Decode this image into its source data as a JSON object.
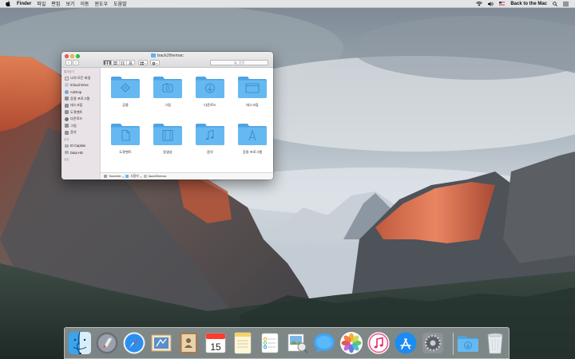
{
  "menubar": {
    "app_name": "Finder",
    "menus": [
      "파일",
      "편집",
      "보기",
      "이동",
      "윈도우",
      "도움말"
    ],
    "username": "Back to the Mac",
    "status_icons": [
      "wifi-icon",
      "speaker-icon",
      "flag-icon",
      "spotlight-icon",
      "list-icon"
    ]
  },
  "finder": {
    "title": "back2themac",
    "search_placeholder": "검색",
    "sidebar": {
      "favorites_header": "즐겨찾기",
      "favorites": [
        {
          "label": "나의 모든 파일",
          "icon": "all-files-icon"
        },
        {
          "label": "iCloud Drive",
          "icon": "icloud-icon"
        },
        {
          "label": "AirDrop",
          "icon": "airdrop-icon"
        },
        {
          "label": "응용 프로그램",
          "icon": "applications-icon"
        },
        {
          "label": "데스크탑",
          "icon": "desktop-icon"
        },
        {
          "label": "도큐멘트",
          "icon": "documents-icon"
        },
        {
          "label": "다운로드",
          "icon": "downloads-icon"
        },
        {
          "label": "그림",
          "icon": "pictures-icon"
        },
        {
          "label": "음악",
          "icon": "music-icon"
        }
      ],
      "devices_header": "장치",
      "devices": [
        {
          "label": "El Capitan",
          "icon": "disk-icon"
        },
        {
          "label": "Data HD",
          "icon": "disk-icon"
        }
      ],
      "shared_header": "공유"
    },
    "folders": [
      {
        "label": "공용",
        "icon": "public-folder-icon"
      },
      {
        "label": "그림",
        "icon": "pictures-folder-icon"
      },
      {
        "label": "다운로드",
        "icon": "downloads-folder-icon"
      },
      {
        "label": "데스크탑",
        "icon": "desktop-folder-icon"
      },
      {
        "label": "도큐멘트",
        "icon": "documents-folder-icon"
      },
      {
        "label": "동영상",
        "icon": "movies-folder-icon"
      },
      {
        "label": "음악",
        "icon": "music-folder-icon"
      },
      {
        "label": "응용 프로그램",
        "icon": "applications-folder-icon"
      }
    ],
    "path": [
      "Yosemite",
      "사용자",
      "back2themac"
    ]
  },
  "dock": {
    "apps": [
      {
        "name": "finder-icon",
        "running": true
      },
      {
        "name": "launchpad-icon",
        "running": false
      },
      {
        "name": "safari-icon",
        "running": false
      },
      {
        "name": "mail-icon",
        "running": false
      },
      {
        "name": "contacts-icon",
        "running": false
      },
      {
        "name": "calendar-icon",
        "running": false
      },
      {
        "name": "notes-icon",
        "running": false
      },
      {
        "name": "reminders-icon",
        "running": false
      },
      {
        "name": "preview-icon",
        "running": false
      },
      {
        "name": "messages-icon",
        "running": false
      },
      {
        "name": "photos-icon",
        "running": false
      },
      {
        "name": "itunes-icon",
        "running": false
      },
      {
        "name": "app-store-icon",
        "running": false
      },
      {
        "name": "system-preferences-icon",
        "running": false
      },
      {
        "name": "downloads-stack-icon",
        "running": false
      },
      {
        "name": "trash-icon",
        "running": false
      }
    ],
    "calendar_day": "15",
    "colors": {
      "folder": "#66b9f0",
      "folder_dark": "#4fa3e0",
      "accent": "#1d8cf2"
    }
  }
}
